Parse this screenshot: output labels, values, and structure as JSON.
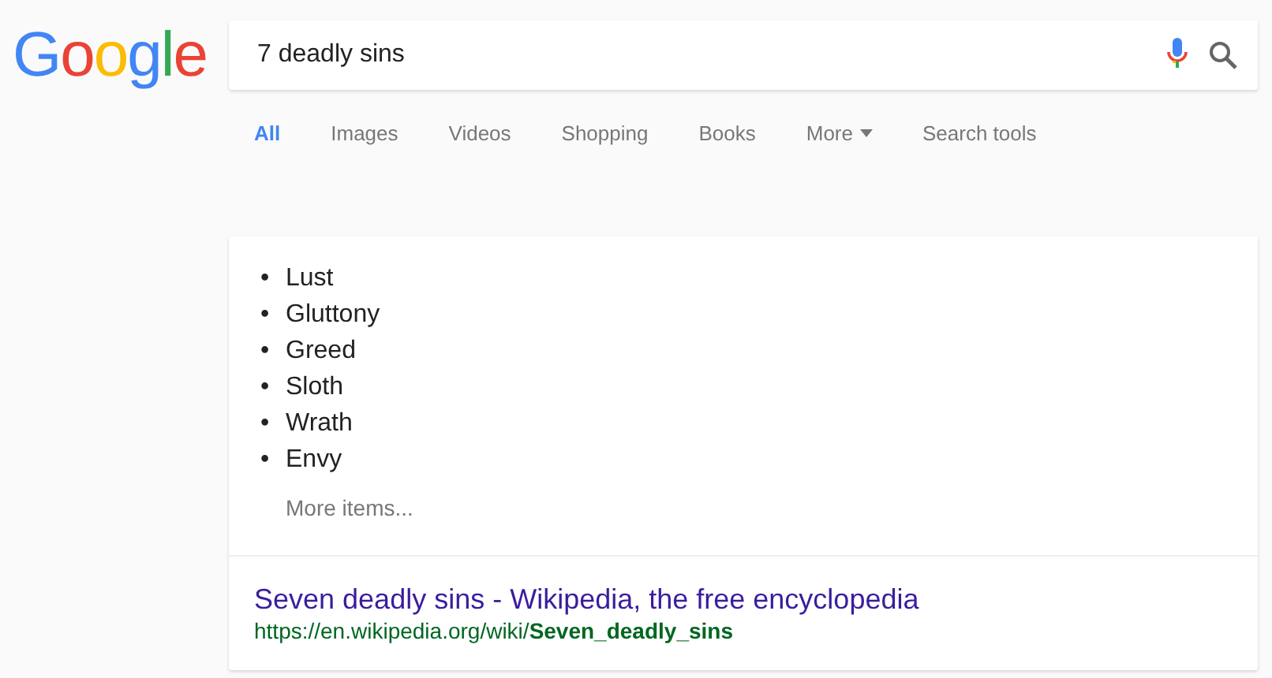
{
  "logo": "Google",
  "search": {
    "value": "7 deadly sins"
  },
  "tabs": [
    {
      "label": "All",
      "selected": true
    },
    {
      "label": "Images",
      "selected": false
    },
    {
      "label": "Videos",
      "selected": false
    },
    {
      "label": "Shopping",
      "selected": false
    },
    {
      "label": "Books",
      "selected": false
    },
    {
      "label": "More",
      "selected": false,
      "kind": "menu"
    },
    {
      "label": "Search tools",
      "selected": false
    }
  ],
  "result": {
    "items": [
      {
        "bullet": "•",
        "text": "Lust"
      },
      {
        "bullet": "•",
        "text": "Gluttony"
      },
      {
        "bullet": "•",
        "text": "Greed"
      },
      {
        "bullet": "•",
        "text": "Sloth"
      },
      {
        "bullet": "•",
        "text": "Wrath"
      },
      {
        "bullet": "•",
        "text": "Envy"
      }
    ],
    "more_link": "More items...",
    "title": "Seven deadly sins - Wikipedia, the free encyclopedia",
    "url": "https://en.wikipedia.org/wiki/**Seven_deadly_sins**"
  }
}
